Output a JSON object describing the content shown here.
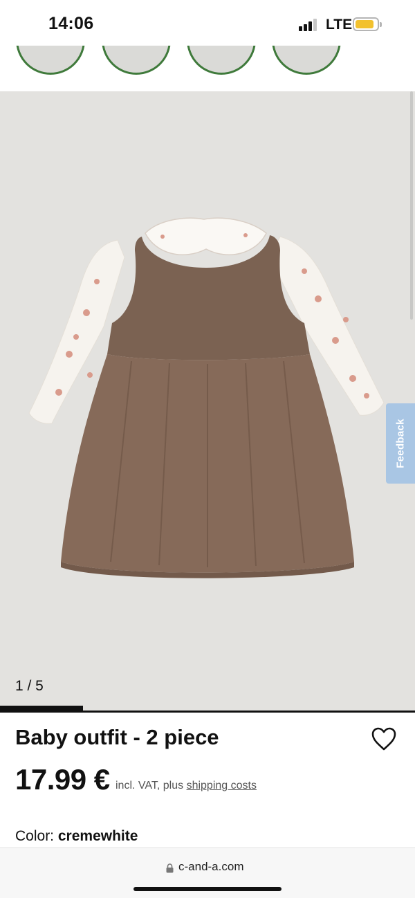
{
  "status_bar": {
    "time": "14:06",
    "network": "LTE",
    "battery_level": 0.72,
    "battery_color": "#f2c12e"
  },
  "swatches": [
    {
      "name": "swatch-1"
    },
    {
      "name": "swatch-2"
    },
    {
      "name": "swatch-3"
    },
    {
      "name": "swatch-4"
    }
  ],
  "gallery": {
    "counter": "1 / 5",
    "current": 1,
    "total": 5,
    "background": "#e3e2df"
  },
  "feedback": {
    "label": "Feedback"
  },
  "product": {
    "title": "Baby outfit - 2 piece",
    "price": "17.99 €",
    "vat_prefix": "incl. VAT, plus",
    "shipping_link": "shipping costs",
    "color_label": "Color:",
    "color_value": "cremewhite"
  },
  "browser": {
    "url": "c-and-a.com"
  },
  "icons": {
    "wishlist": "heart-icon",
    "lock": "lock-icon",
    "signal": "signal-icon",
    "battery": "battery-icon"
  }
}
